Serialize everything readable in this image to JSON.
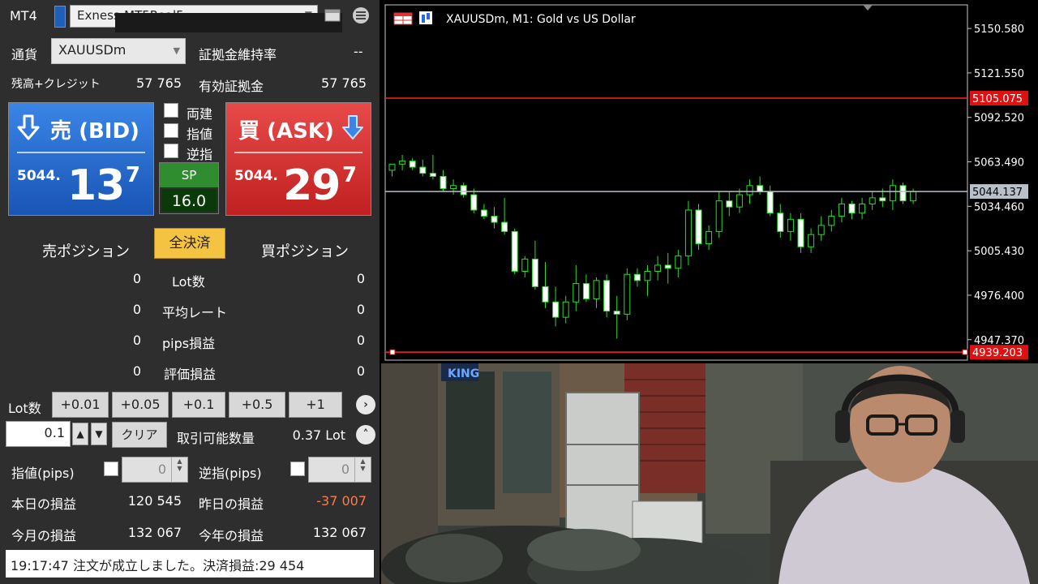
{
  "panel": {
    "app_label": "MT4",
    "account_name": "Exness-MT5Real5",
    "currency_label": "通貨",
    "symbol_value": "XAUUSDm",
    "margin_level_label": "証拠金維持率",
    "margin_level_value": "--",
    "balance_label": "残高+クレジット",
    "balance_value": "57 765",
    "equity_label": "有効証拠金",
    "equity_value": "57 765",
    "sell": {
      "title": "売 (BID)",
      "price_prefix": "5044.",
      "price_main": "13",
      "price_sup": "7"
    },
    "buy": {
      "title": "買 (ASK)",
      "price_prefix": "5044.",
      "price_main": "29",
      "price_sup": "7"
    },
    "options": [
      {
        "label": "両建",
        "checked": false
      },
      {
        "label": "指値",
        "checked": false
      },
      {
        "label": "逆指",
        "checked": false
      }
    ],
    "spread_label": "SP",
    "spread_value": "16.0",
    "sell_positions_label": "売ポジション",
    "buy_positions_label": "買ポジション",
    "close_all_label": "全決済",
    "stats": [
      {
        "label": "Lot数",
        "sell": "0",
        "buy": "0"
      },
      {
        "label": "平均レート",
        "sell": "0",
        "buy": "0"
      },
      {
        "label": "pips損益",
        "sell": "0",
        "buy": "0"
      },
      {
        "label": "評価損益",
        "sell": "0",
        "buy": "0"
      }
    ],
    "lot_label": "Lot数",
    "lot_buttons": [
      "+0.01",
      "+0.05",
      "+0.1",
      "+0.5",
      "+1"
    ],
    "lot_value": "0.1",
    "clear_label": "クリア",
    "tradable_label": "取引可能数量",
    "tradable_value": "0.37 Lot",
    "limit_label": "指値(pips)",
    "limit_value": "0",
    "stop_label": "逆指(pips)",
    "stop_value": "0",
    "today_pl_label": "本日の損益",
    "today_pl_value": "120 545",
    "yesterday_pl_label": "昨日の損益",
    "yesterday_pl_value": "-37 007",
    "month_pl_label": "今月の損益",
    "month_pl_value": "132 067",
    "year_pl_label": "今年の損益",
    "year_pl_value": "132 067",
    "status_message": "19:17:47 注文が成立しました。決済損益:29 454",
    "colors": {
      "negative": "#ff7a45",
      "sell": "#1f6fd8",
      "buy": "#d83030",
      "spread": "#2f8c2f"
    }
  },
  "chart_data": {
    "type": "candlestick",
    "title": "XAUUSDm, M1:  Gold vs US Dollar",
    "y_ticks": [
      "5150.580",
      "5121.550",
      "5092.520",
      "5063.490",
      "5034.460",
      "5005.430",
      "4976.400",
      "4947.370"
    ],
    "ylim": [
      4934.0,
      5166.0
    ],
    "price_lines": [
      {
        "value": 5105.075,
        "label": "5105.075",
        "color": "#ff2020"
      },
      {
        "value": 5044.137,
        "label": "5044.137",
        "color": "#b8c0c8"
      },
      {
        "value": 4939.203,
        "label": "4939.203",
        "color": "#ff2020"
      }
    ],
    "candles": [
      [
        5058,
        5062,
        5054,
        5062
      ],
      [
        5062,
        5068,
        5058,
        5064
      ],
      [
        5064,
        5066,
        5058,
        5060
      ],
      [
        5060,
        5065,
        5054,
        5056
      ],
      [
        5056,
        5068,
        5052,
        5054
      ],
      [
        5054,
        5058,
        5044,
        5046
      ],
      [
        5046,
        5052,
        5042,
        5048
      ],
      [
        5048,
        5050,
        5040,
        5042
      ],
      [
        5042,
        5046,
        5030,
        5032
      ],
      [
        5032,
        5036,
        5026,
        5028
      ],
      [
        5028,
        5034,
        5020,
        5024
      ],
      [
        5024,
        5040,
        5016,
        5018
      ],
      [
        5018,
        5020,
        4990,
        4992
      ],
      [
        4992,
        5002,
        4988,
        5000
      ],
      [
        5000,
        5012,
        4980,
        4982
      ],
      [
        4982,
        4998,
        4968,
        4972
      ],
      [
        4972,
        4982,
        4956,
        4962
      ],
      [
        4962,
        4976,
        4958,
        4972
      ],
      [
        4972,
        4996,
        4966,
        4984
      ],
      [
        4984,
        4990,
        4972,
        4974
      ],
      [
        4974,
        4988,
        4968,
        4986
      ],
      [
        4986,
        4990,
        4962,
        4966
      ],
      [
        4966,
        4976,
        4948,
        4964
      ],
      [
        4964,
        4994,
        4960,
        4990
      ],
      [
        4990,
        4994,
        4982,
        4986
      ],
      [
        4986,
        4996,
        4976,
        4992
      ],
      [
        4992,
        5002,
        4986,
        4996
      ],
      [
        4996,
        5004,
        4984,
        4994
      ],
      [
        4994,
        5006,
        4988,
        5002
      ],
      [
        5002,
        5038,
        4996,
        5032
      ],
      [
        5032,
        5036,
        5006,
        5010
      ],
      [
        5010,
        5022,
        5006,
        5018
      ],
      [
        5018,
        5044,
        5014,
        5038
      ],
      [
        5038,
        5044,
        5028,
        5034
      ],
      [
        5034,
        5046,
        5030,
        5042
      ],
      [
        5042,
        5052,
        5036,
        5048
      ],
      [
        5048,
        5054,
        5042,
        5044
      ],
      [
        5044,
        5048,
        5028,
        5030
      ],
      [
        5030,
        5036,
        5014,
        5018
      ],
      [
        5018,
        5030,
        5012,
        5026
      ],
      [
        5026,
        5030,
        5004,
        5008
      ],
      [
        5008,
        5020,
        5004,
        5016
      ],
      [
        5016,
        5028,
        5012,
        5022
      ],
      [
        5022,
        5032,
        5018,
        5028
      ],
      [
        5028,
        5040,
        5024,
        5036
      ],
      [
        5036,
        5038,
        5026,
        5030
      ],
      [
        5030,
        5040,
        5026,
        5036
      ],
      [
        5036,
        5044,
        5032,
        5040
      ],
      [
        5040,
        5046,
        5034,
        5038
      ],
      [
        5038,
        5052,
        5032,
        5048
      ],
      [
        5048,
        5050,
        5036,
        5038
      ],
      [
        5038,
        5046,
        5036,
        5044
      ]
    ]
  }
}
